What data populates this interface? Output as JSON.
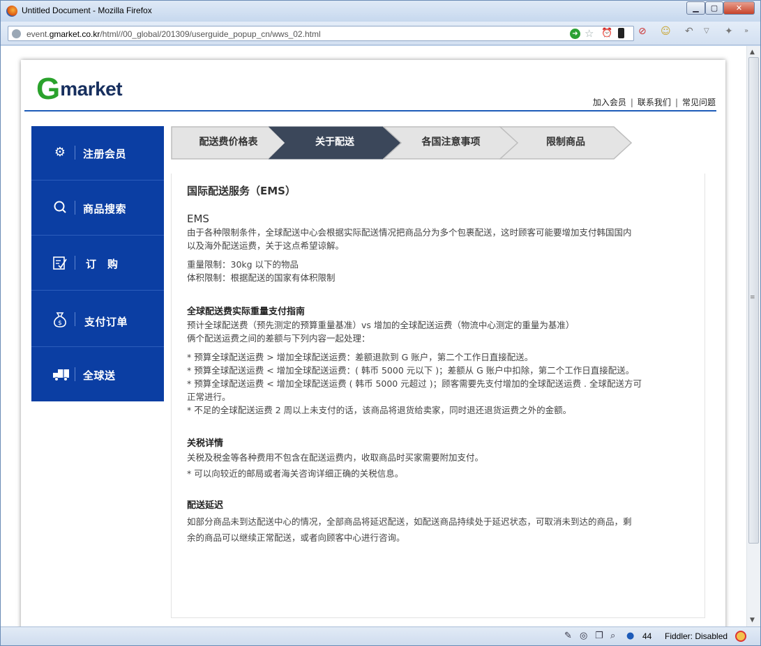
{
  "browser": {
    "title": "Untitled Document - Mozilla Firefox",
    "url_prefix": "event.",
    "url_domain": "gmarket.co.kr",
    "url_path": "/html//00_global/201309/userguide_popup_cn/wws_02.html",
    "status_count": "44",
    "fiddler_status": "Fiddler: Disabled"
  },
  "header": {
    "logo_g": "G",
    "logo_rest": "market",
    "links": [
      "加入会员",
      "联系我们",
      "常见问题"
    ]
  },
  "sidebar": {
    "items": [
      {
        "label": "注册会员",
        "icon": "gear-icon"
      },
      {
        "label": "商品搜索",
        "icon": "search-icon"
      },
      {
        "label": "订　购",
        "icon": "order-form-icon"
      },
      {
        "label": "支付订单",
        "icon": "money-bag-icon"
      },
      {
        "label": "全球送",
        "icon": "delivery-truck-icon"
      }
    ]
  },
  "tabs": [
    {
      "label": "配送费价格表",
      "active": false
    },
    {
      "label": "关于配送",
      "active": true
    },
    {
      "label": "各国注意事项",
      "active": false
    },
    {
      "label": "限制商品",
      "active": false
    }
  ],
  "content": {
    "title": "国际配送服务（EMS）",
    "ems_heading": "EMS",
    "ems_desc_1": "由于各种限制条件，全球配送中心会根据实际配送情况把商品分为多个包裹配送，这时顾客可能要增加支付韩国国内",
    "ems_desc_2": "以及海外配送运费，关于这点希望谅解。",
    "weight_limit": "重量限制：30kg 以下的物品",
    "volume_limit": "体积限制：根据配送的国家有体积限制",
    "guide_heading": "全球配送费实际重量支付指南",
    "guide_desc_1": "预计全球配送费（预先测定的预算重量基准）vs 增加的全球配送运费（物流中心测定的重量为基准）",
    "guide_desc_2": "俩个配送运费之间的差额与下列内容一起处理：",
    "guide_items": [
      "* 预算全球配送运费 > 增加全球配送运费：差额退款到 G 账户，第二个工作日直接配送。",
      "* 预算全球配送运费 < 增加全球配送运费：( 韩币 5000 元以下 )；差额从 G 账户中扣除，第二个工作日直接配送。",
      "* 预算全球配送运费 < 增加全球配送运费 ( 韩币 5000 元超过 )；顾客需要先支付增加的全球配送运费 . 全球配送方可",
      "正常进行。",
      "* 不足的全球配送运费 2 周以上未支付的话，该商品将退货给卖家，同时退还退货运费之外的金额。"
    ],
    "tax_heading": "关税详情",
    "tax_desc": "关税及税金等各种费用不包含在配送运费内，收取商品时买家需要附加支付。",
    "tax_note": "* 可以向较近的邮局或者海关咨询详细正确的关税信息。",
    "delay_heading": "配送延迟",
    "delay_desc_1": "如部分商品未到达配送中心的情况，全部商品将延迟配送，如配送商品持续处于延迟状态，可取消未到达的商品，剩",
    "delay_desc_2": "余的商品可以继续正常配送，或者向顾客中心进行咨询。"
  },
  "colors": {
    "sidebar_bg": "#0b3ea3",
    "tab_active_bg": "#3b475a",
    "tab_inactive_bg": "#e4e4e4",
    "logo_green": "#2aa22c",
    "logo_navy": "#172f5e"
  }
}
